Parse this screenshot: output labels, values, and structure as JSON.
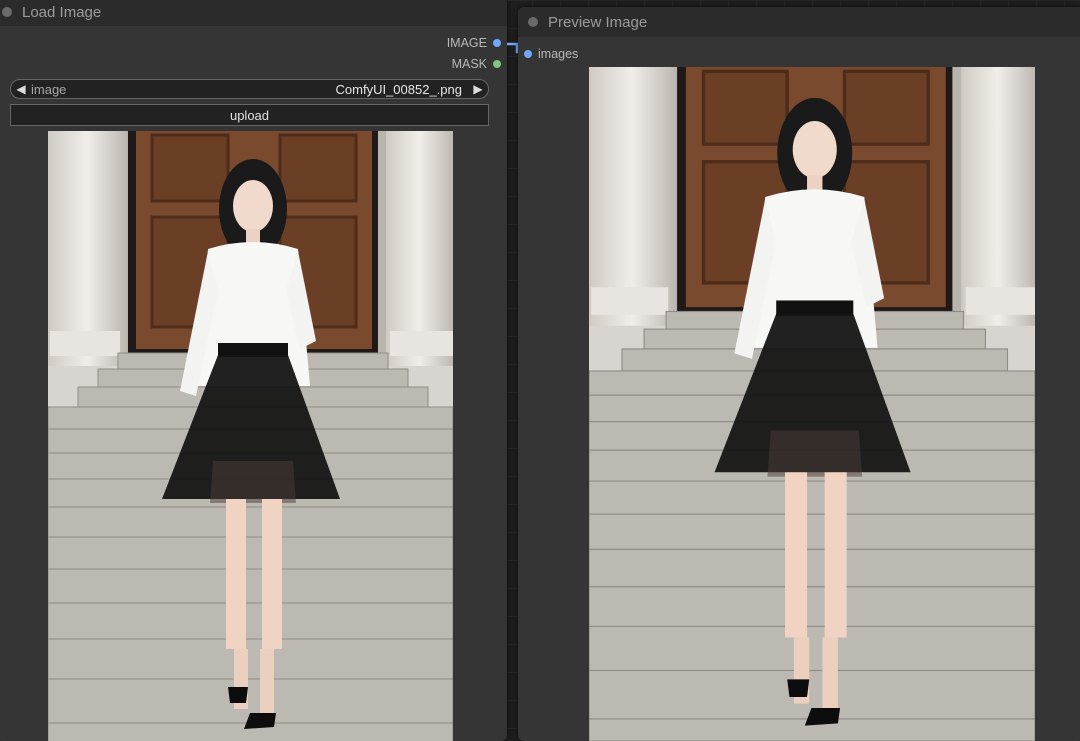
{
  "load_node": {
    "title": "Load Image",
    "outputs": [
      {
        "label": "IMAGE",
        "color": "#6fa8ff"
      },
      {
        "label": "MASK",
        "color": "#7ec77e"
      }
    ],
    "image_widget": {
      "label": "image",
      "value": "ComfyUI_00852_.png"
    },
    "upload_label": "upload",
    "image_icon": "photo-woman-on-stairs"
  },
  "preview_node": {
    "title": "Preview Image",
    "inputs": [
      {
        "label": "images",
        "color": "#6fa8ff"
      }
    ],
    "image_icon": "photo-woman-on-stairs"
  },
  "colors": {
    "node_bg": "#353535",
    "header_bg": "#2b2b2b",
    "link": "#6fa8ff"
  }
}
